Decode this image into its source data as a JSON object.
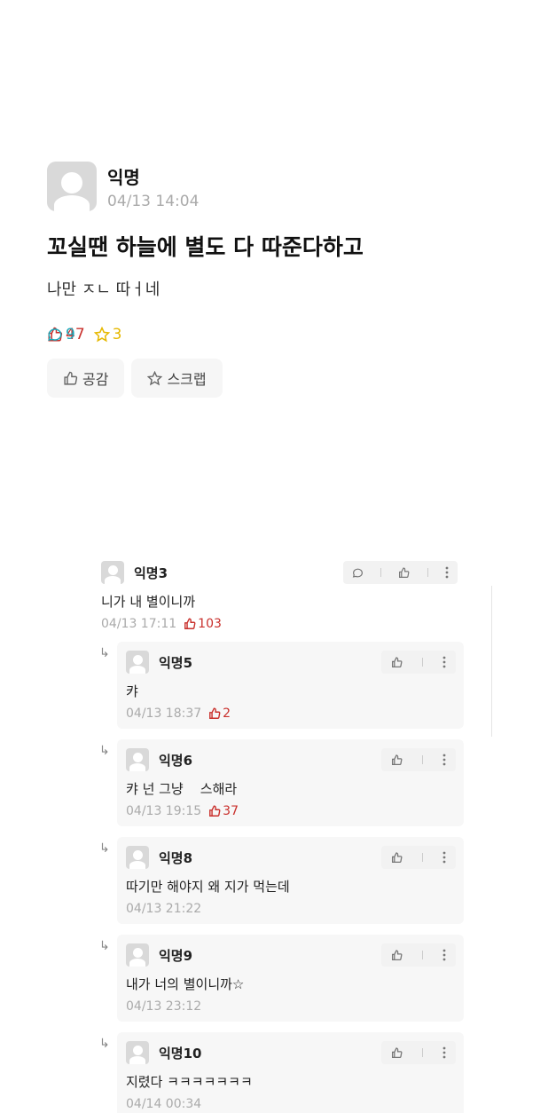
{
  "post": {
    "author": "익명",
    "time": "04/13 14:04",
    "title": "꼬실땐 하늘에 별도 다 따준다하고",
    "body": "나만 ㅈㄴ 따ㅓ네",
    "likes": "47",
    "comments": "9",
    "scraps": "3",
    "like_button": "공감",
    "scrap_button": "스크랩"
  },
  "comments": [
    {
      "author": "익명3",
      "text": "니가 내 별이니까",
      "time": "04/13 17:11",
      "votes": "103"
    }
  ],
  "replies": [
    {
      "author": "익명5",
      "text": "캬",
      "time": "04/13 18:37",
      "votes": "2"
    },
    {
      "author": "익명6",
      "text": "캬 넌 그냥    스해라",
      "time": "04/13 19:15",
      "votes": "37"
    },
    {
      "author": "익명8",
      "text": "따기만 해야지 왜 지가 먹는데",
      "time": "04/13 21:22",
      "votes": ""
    },
    {
      "author": "익명9",
      "text": "내가 너의 별이니까☆",
      "time": "04/13 23:12",
      "votes": ""
    },
    {
      "author": "익명10",
      "text": "지렸다 ㅋㅋㅋㅋㅋㅋㅋ",
      "time": "04/14 00:34",
      "votes": ""
    }
  ],
  "reply_arrow": "↳",
  "colors": {
    "vote": "#c9302c",
    "comment": "#1aa7b8",
    "scrap": "#e6b800"
  }
}
